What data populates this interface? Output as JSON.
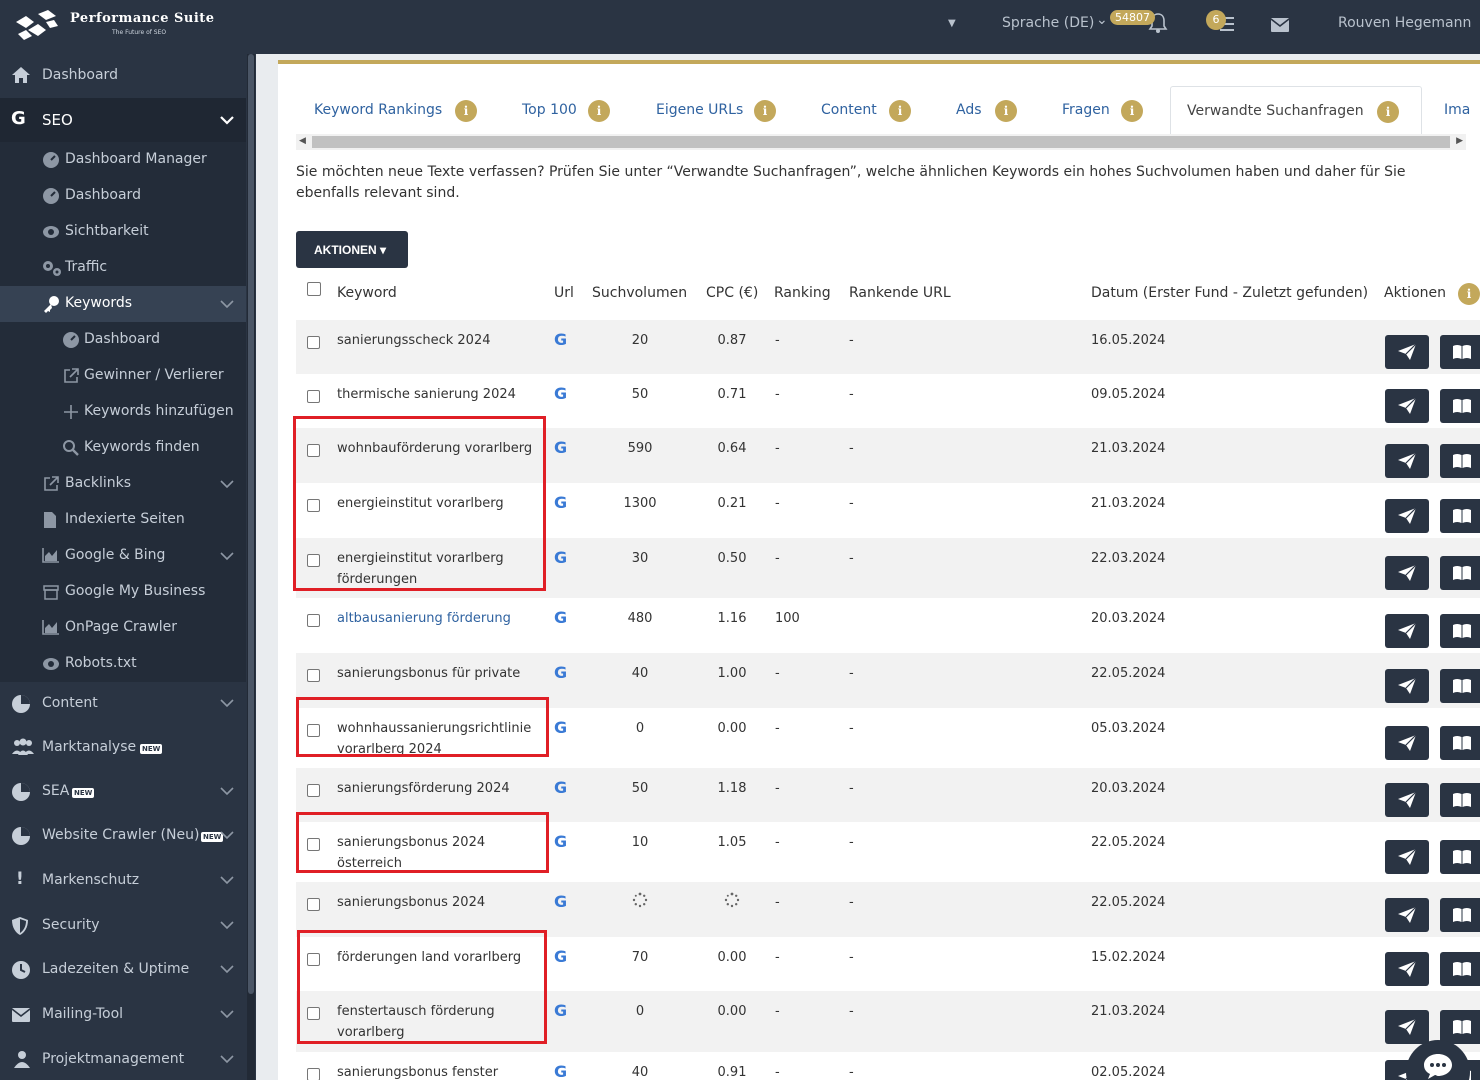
{
  "header": {
    "brand_name": "Performance Suite",
    "brand_tagline": "The Future of SEO",
    "language": "Sprache (DE)",
    "notifications_count": "54807",
    "tasks_count": "6",
    "user_name": "Rouven Hegemann"
  },
  "sidebar": {
    "items": [
      {
        "label": "Dashboard",
        "icon": "home-icon"
      },
      {
        "label": "SEO",
        "icon": "google-icon"
      },
      {
        "label": "Dashboard Manager",
        "icon": "gauge-icon"
      },
      {
        "label": "Dashboard",
        "icon": "gauge-icon"
      },
      {
        "label": "Sichtbarkeit",
        "icon": "eye-icon"
      },
      {
        "label": "Traffic",
        "icon": "cogs-icon"
      },
      {
        "label": "Keywords",
        "icon": "key-icon"
      },
      {
        "label": "Dashboard",
        "icon": "gauge-icon"
      },
      {
        "label": "Gewinner / Verlierer",
        "icon": "external-link-icon"
      },
      {
        "label": "Keywords hinzufügen",
        "icon": "plus-icon"
      },
      {
        "label": "Keywords finden",
        "icon": "search-icon"
      },
      {
        "label": "Backlinks",
        "icon": "external-link-icon"
      },
      {
        "label": "Indexierte Seiten",
        "icon": "file-icon"
      },
      {
        "label": "Google & Bing",
        "icon": "area-chart-icon"
      },
      {
        "label": "Google My Business",
        "icon": "store-icon"
      },
      {
        "label": "OnPage Crawler",
        "icon": "area-chart-icon"
      },
      {
        "label": "Robots.txt",
        "icon": "eye-icon"
      },
      {
        "label": "Content",
        "icon": "pie-chart-icon"
      },
      {
        "label": "Marktanalyse",
        "icon": "users-icon"
      },
      {
        "label": "SEA",
        "icon": "pie-chart-icon"
      },
      {
        "label": "Website Crawler (Neu)",
        "icon": "pie-chart-icon"
      },
      {
        "label": "Markenschutz",
        "icon": "exclamation-icon"
      },
      {
        "label": "Security",
        "icon": "shield-icon"
      },
      {
        "label": "Ladezeiten & Uptime",
        "icon": "clock-icon"
      },
      {
        "label": "Mailing-Tool",
        "icon": "envelope-icon"
      },
      {
        "label": "Projektmanagement",
        "icon": "user-group-icon"
      }
    ],
    "new_badge": "NEW"
  },
  "tabs": [
    {
      "label": "Keyword Rankings",
      "info": "i"
    },
    {
      "label": "Top 100",
      "info": "i"
    },
    {
      "label": "Eigene URLs",
      "info": "i"
    },
    {
      "label": "Content",
      "info": "i"
    },
    {
      "label": "Ads",
      "info": "i"
    },
    {
      "label": "Fragen",
      "info": "i"
    },
    {
      "label": "Verwandte Suchanfragen",
      "info": "i"
    },
    {
      "label": "Ima"
    }
  ],
  "intro_text": "Sie möchten neue Texte verfassen? Prüfen Sie unter “Verwandte Suchanfragen”, welche ähnlichen Keywords ein hohes Suchvolumen haben und daher für Sie ebenfalls relevant sind.",
  "actions_button": "AKTIONEN",
  "table": {
    "columns": {
      "keyword": "Keyword",
      "url": "Url",
      "volume": "Suchvolumen",
      "cpc": "CPC (€)",
      "ranking": "Ranking",
      "ranking_url": "Rankende URL",
      "date": "Datum (Erster Fund - Zuletzt gefunden)",
      "actions": "Aktionen",
      "actions_info": "i"
    },
    "google_mark": "G",
    "rows": [
      {
        "keyword": "sanierungsscheck 2024",
        "volume": "20",
        "cpc": "0.87",
        "ranking": "-",
        "ranking_url": "-",
        "date": "16.05.2024"
      },
      {
        "keyword": "thermische sanierung 2024",
        "volume": "50",
        "cpc": "0.71",
        "ranking": "-",
        "ranking_url": "-",
        "date": "09.05.2024"
      },
      {
        "keyword": "wohnbauförderung vorarlberg",
        "volume": "590",
        "cpc": "0.64",
        "ranking": "-",
        "ranking_url": "-",
        "date": "21.03.2024"
      },
      {
        "keyword": "energieinstitut vorarlberg",
        "volume": "1300",
        "cpc": "0.21",
        "ranking": "-",
        "ranking_url": "-",
        "date": "21.03.2024"
      },
      {
        "keyword": "energieinstitut vorarlberg förderungen",
        "volume": "30",
        "cpc": "0.50",
        "ranking": "-",
        "ranking_url": "-",
        "date": "22.03.2024"
      },
      {
        "keyword": "altbausanierung förderung",
        "volume": "480",
        "cpc": "1.16",
        "ranking": "100",
        "ranking_url": "",
        "date": "20.03.2024",
        "link": true
      },
      {
        "keyword": "sanierungsbonus für private",
        "volume": "40",
        "cpc": "1.00",
        "ranking": "-",
        "ranking_url": "-",
        "date": "22.05.2024"
      },
      {
        "keyword": "wohnhaussanierungsrichtlinie vorarlberg 2024",
        "volume": "0",
        "cpc": "0.00",
        "ranking": "-",
        "ranking_url": "-",
        "date": "05.03.2024"
      },
      {
        "keyword": "sanierungsförderung 2024",
        "volume": "50",
        "cpc": "1.18",
        "ranking": "-",
        "ranking_url": "-",
        "date": "20.03.2024"
      },
      {
        "keyword": "sanierungsbonus 2024 österreich",
        "volume": "10",
        "cpc": "1.05",
        "ranking": "-",
        "ranking_url": "-",
        "date": "22.05.2024"
      },
      {
        "keyword": "sanierungsbonus 2024",
        "volume": "",
        "cpc": "",
        "ranking": "-",
        "ranking_url": "-",
        "date": "22.05.2024",
        "loading": true
      },
      {
        "keyword": "förderungen land vorarlberg",
        "volume": "70",
        "cpc": "0.00",
        "ranking": "-",
        "ranking_url": "-",
        "date": "15.02.2024"
      },
      {
        "keyword": "fenstertausch förderung vorarlberg",
        "volume": "0",
        "cpc": "0.00",
        "ranking": "-",
        "ranking_url": "-",
        "date": "21.03.2024"
      },
      {
        "keyword": "sanierungsbonus fenster",
        "volume": "40",
        "cpc": "0.91",
        "ranking": "-",
        "ranking_url": "-",
        "date": "02.05.2024"
      }
    ]
  },
  "colors": {
    "sidebar_bg": "#2a3443",
    "accent_gold": "#c3a85b",
    "link_blue": "#2f62a0",
    "highlight_red": "#e01f26"
  }
}
